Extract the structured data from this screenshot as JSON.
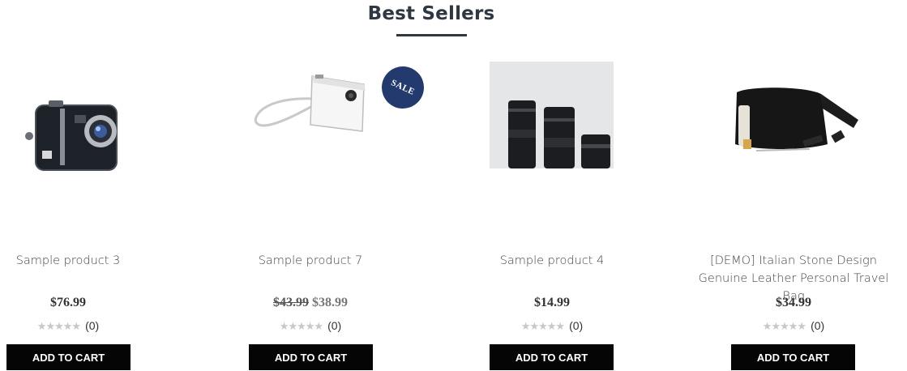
{
  "section": {
    "title": "Best Sellers"
  },
  "colors": {
    "accent": "#223a6e",
    "button": "#050505",
    "title": "#2f3742"
  },
  "products": [
    {
      "name": "Sample product 3",
      "price": "$76.99",
      "rating_count": "(0)",
      "cart_label": "ADD TO CART",
      "image_icon": "compact-camera-icon"
    },
    {
      "name": "Sample product 7",
      "old_price": "$43.99",
      "price": "$38.99",
      "rating_count": "(0)",
      "cart_label": "ADD TO CART",
      "badge": "SALE",
      "image_icon": "white-camera-icon"
    },
    {
      "name": "Sample product 4",
      "price": "$14.99",
      "rating_count": "(0)",
      "cart_label": "ADD TO CART",
      "image_icon": "camera-lenses-icon"
    },
    {
      "name": "[DEMO] Italian Stone Design Genuine Leather Personal Travel Bag",
      "price": "$34.99",
      "rating_count": "(0)",
      "cart_label": "ADD TO CART",
      "image_icon": "travel-bag-icon"
    }
  ],
  "rating": {
    "stars": "★★★★★",
    "value": 0,
    "max": 5
  }
}
